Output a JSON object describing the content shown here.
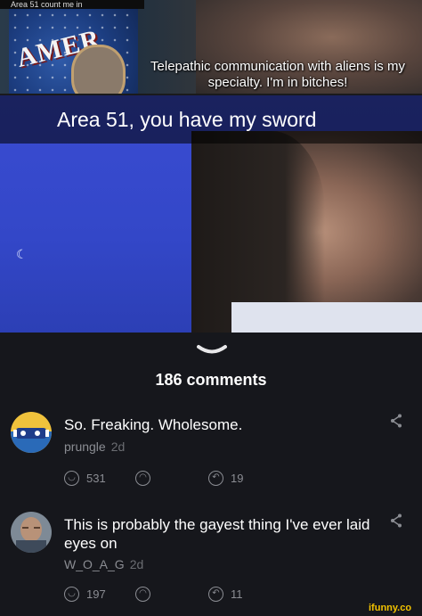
{
  "meme": {
    "top_strip_text": "Area 51 count me in",
    "poster_text": "AMER",
    "caption_top": "Telepathic communication with aliens is my specialty. I'm in bitches!",
    "caption_bottom": "Area 51, you have my sword"
  },
  "comments_header": {
    "count_label": "186 comments"
  },
  "comments": [
    {
      "text": "So. Freaking. Wholesome.",
      "author": "prungle",
      "time": "2d",
      "upvotes": "531",
      "replies": "19"
    },
    {
      "text": "This is probably the gayest thing I've ever laid eyes on",
      "author": "W_O_A_G",
      "time": "2d",
      "upvotes": "197",
      "replies": "11"
    }
  ],
  "icons": {
    "share": "share-icon",
    "upvote": "smile-icon",
    "downvote": "frown-icon",
    "reply": "reply-icon"
  },
  "watermark": "ifunny.co"
}
